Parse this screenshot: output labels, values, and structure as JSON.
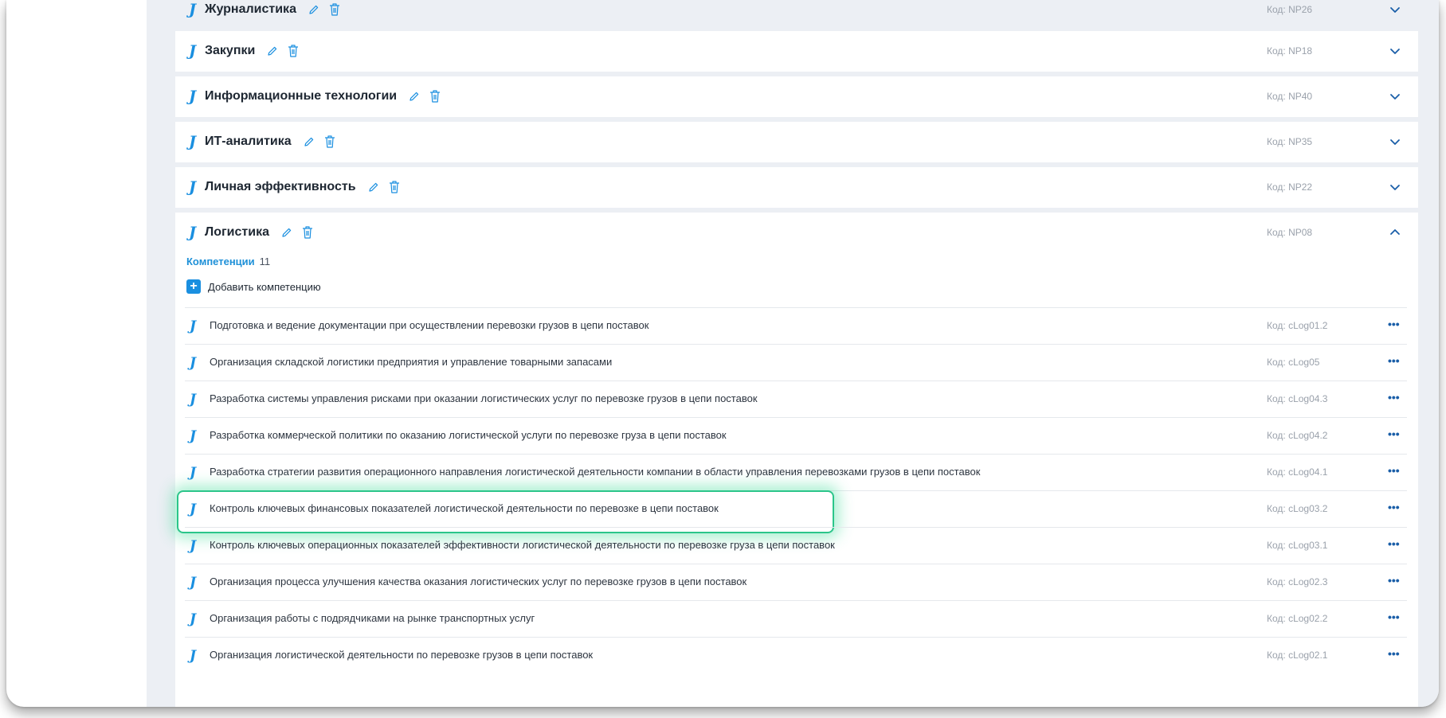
{
  "categories": [
    {
      "title": "Журналистика",
      "code": "Код: NP26",
      "expanded": false
    },
    {
      "title": "Закупки",
      "code": "Код: NP18",
      "expanded": false
    },
    {
      "title": "Информационные технологии",
      "code": "Код: NP40",
      "expanded": false
    },
    {
      "title": "ИТ-аналитика",
      "code": "Код: NP35",
      "expanded": false
    },
    {
      "title": "Личная эффективность",
      "code": "Код: NP22",
      "expanded": false
    },
    {
      "title": "Логистика",
      "code": "Код: NP08",
      "expanded": true
    }
  ],
  "expanded": {
    "competencies_label": "Компетенции",
    "competencies_count": "11",
    "add_label": "Добавить компетенцию",
    "more_label": "•••",
    "rows": [
      {
        "text": "Подготовка и ведение документации при осуществлении перевозки грузов в цепи поставок",
        "code": "Код: cLog01.2"
      },
      {
        "text": "Организация складской логистики предприятия и управление товарными запасами",
        "code": "Код: cLog05"
      },
      {
        "text": "Разработка системы управления рисками при оказании логистических услуг по перевозке грузов в цепи поставок",
        "code": "Код: cLog04.3"
      },
      {
        "text": "Разработка коммерческой политики по оказанию логистической услуги по перевозке груза в цепи поставок",
        "code": "Код: cLog04.2"
      },
      {
        "text": "Разработка стратегии развития операционного направления логистической деятельности компании в области управления перевозками грузов в цепи поставок",
        "code": "Код: cLog04.1"
      },
      {
        "text": "Контроль ключевых финансовых показателей логистической деятельности по перевозке в цепи поставок",
        "code": "Код: cLog03.2",
        "highlighted": true
      },
      {
        "text": "Контроль ключевых операционных показателей эффективности логистической деятельности по перевозке груза в цепи поставок",
        "code": "Код: cLog03.1"
      },
      {
        "text": "Организация процесса улучшения качества оказания логистических услуг по перевозке грузов в цепи поставок",
        "code": "Код: cLog02.3"
      },
      {
        "text": "Организация работы с подрядчиками на рынке транспортных услуг",
        "code": "Код: cLog02.2"
      },
      {
        "text": "Организация логистической деятельности по перевозке грузов в цепи поставок",
        "code": "Код: cLog02.1"
      }
    ]
  },
  "icons": {
    "logo": "J",
    "edit": "pencil-icon",
    "delete": "trash-icon",
    "chevron_down": "chevron-down-icon",
    "chevron_up": "chevron-up-icon",
    "more": "more-dots-icon",
    "add": "plus-icon"
  },
  "colors": {
    "accent": "#1a8fe0",
    "highlight": "#2bc58a",
    "background": "#eceff4"
  }
}
